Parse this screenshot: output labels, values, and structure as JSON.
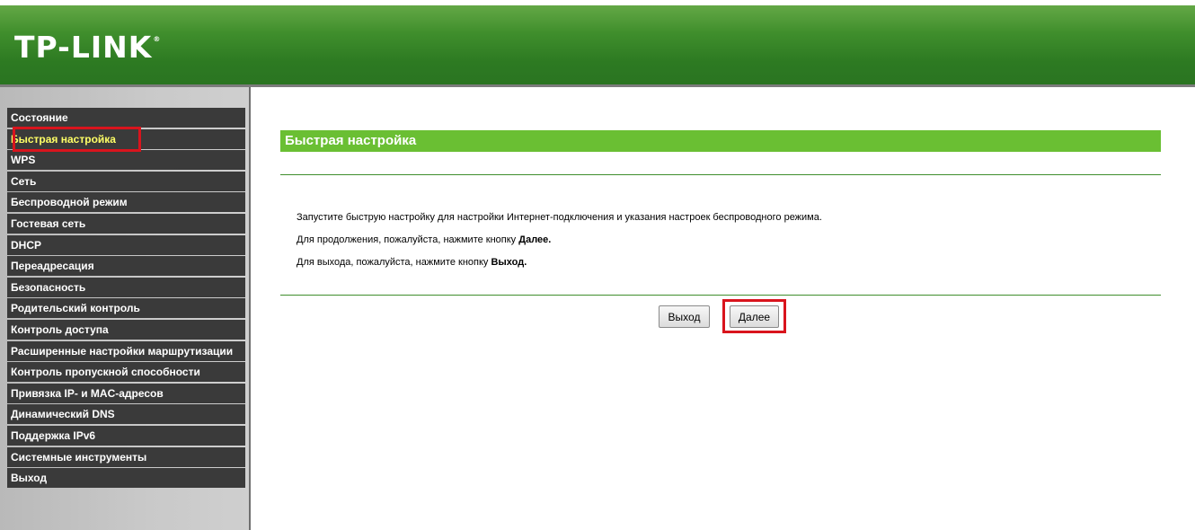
{
  "header": {
    "logo_text": "TP-LINK",
    "logo_mark": "®"
  },
  "sidebar": {
    "items": [
      {
        "label": "Состояние"
      },
      {
        "label": "Быстрая настройка",
        "active": true
      },
      {
        "label": "WPS"
      },
      {
        "label": "Сеть"
      },
      {
        "label": "Беспроводной режим"
      },
      {
        "label": "Гостевая сеть"
      },
      {
        "label": "DHCP"
      },
      {
        "label": "Переадресация"
      },
      {
        "label": "Безопасность"
      },
      {
        "label": "Родительский контроль"
      },
      {
        "label": "Контроль доступа"
      },
      {
        "label": "Расширенные настройки маршрутизации"
      },
      {
        "label": "Контроль пропускной способности"
      },
      {
        "label": "Привязка IP- и MAC-адресов"
      },
      {
        "label": "Динамический DNS"
      },
      {
        "label": "Поддержка IPv6"
      },
      {
        "label": "Системные инструменты"
      },
      {
        "label": "Выход"
      }
    ]
  },
  "main": {
    "title": "Быстрая настройка",
    "line1": "Запустите быструю настройку для настройки Интернет-подключения и указания настроек беспроводного режима.",
    "line2_prefix": "Для продолжения, пожалуйста, нажмите кнопку ",
    "line2_bold": "Далее.",
    "line3_prefix": "Для выхода, пожалуйста, нажмите кнопку ",
    "line3_bold": "Выход.",
    "exit_button": "Выход",
    "next_button": "Далее"
  },
  "colors": {
    "header_green": "#3f8e2c",
    "title_green": "#6abf33",
    "menu_bg": "#3a3a3a",
    "menu_active_text": "#ffff66",
    "highlight_red": "#d9141d"
  }
}
